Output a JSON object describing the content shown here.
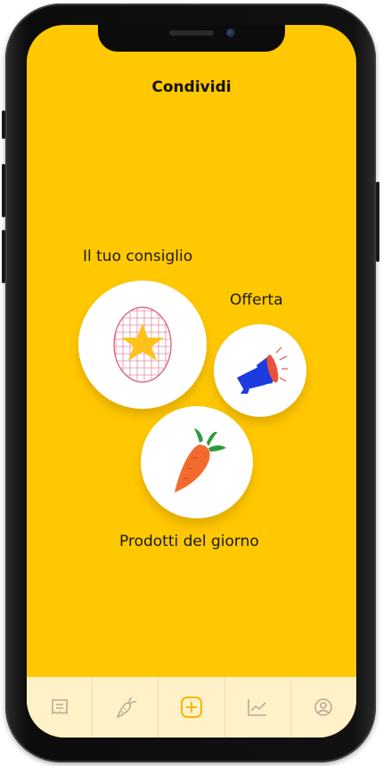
{
  "header": {
    "title": "Condividi"
  },
  "options": {
    "tip": {
      "label": "Il tuo consiglio",
      "icon": "star-in-egg-icon"
    },
    "offer": {
      "label": "Offerta",
      "icon": "megaphone-icon"
    },
    "products": {
      "label": "Prodotti del giorno",
      "icon": "carrot-icon"
    }
  },
  "tabs": [
    {
      "name": "receipt",
      "icon": "receipt-icon"
    },
    {
      "name": "products",
      "icon": "carrot-outline-icon"
    },
    {
      "name": "add",
      "icon": "plus-square-icon",
      "active": true
    },
    {
      "name": "stats",
      "icon": "chart-line-icon"
    },
    {
      "name": "profile",
      "icon": "user-circle-icon"
    }
  ],
  "colors": {
    "background": "#FFC800",
    "tabbar": "#FFF1C8",
    "tab_icon": "#B8AC90",
    "tab_active": "#F5B800",
    "star": "#FFC21A",
    "egg_grid": "#E68AA0",
    "megaphone": "#1E3BE0",
    "carrot": "#F26A2E",
    "carrot_leaves": "#2E9B3C"
  }
}
